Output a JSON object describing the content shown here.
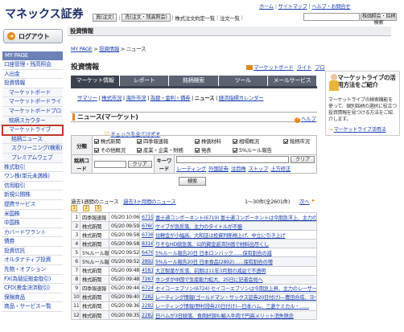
{
  "header": {
    "logo": "マネックス証券",
    "top_links": [
      "ホーム",
      "サイトマップ",
      "ヘルプ・お問合せ"
    ],
    "nav_buttons": [
      "買(注文)",
      "売(注文・残高照会)"
    ],
    "nav_links": [
      "株式注文約定一覧",
      "注文一覧"
    ],
    "search_button": "株価照会・銘柄検索"
  },
  "sidebar": {
    "logout": "ログアウト",
    "head": "MY PAGE",
    "items": [
      {
        "label": "口座管理・残高照会",
        "level": 0
      },
      {
        "label": "入出金",
        "level": 0
      },
      {
        "label": "投資情報",
        "level": 0
      },
      {
        "label": "マーケットボード",
        "level": 1
      },
      {
        "label": "マーケットボードライト",
        "level": 1
      },
      {
        "label": "マーケットボードプロ",
        "level": 1
      },
      {
        "label": "銘柄スカウター",
        "level": 1
      },
      {
        "label": "マーケットライブ",
        "level": 1,
        "active": true
      },
      {
        "label": "銘柄ニュース",
        "level": 2
      },
      {
        "label": "スクリーニング(検索)",
        "level": 2
      },
      {
        "label": "プレミアムウェブ",
        "level": 2
      },
      {
        "label": "株式取引",
        "level": 0
      },
      {
        "label": "ワン株(単元未満株)",
        "level": 0
      },
      {
        "label": "信用取引",
        "level": 0
      },
      {
        "label": "新規公開株",
        "level": 0
      },
      {
        "label": "提携サービス",
        "level": 0
      },
      {
        "label": "米国株",
        "level": 0
      },
      {
        "label": "中国株",
        "level": 0
      },
      {
        "label": "カバードワラント",
        "level": 0
      },
      {
        "label": "債券",
        "level": 0
      },
      {
        "label": "投資信託",
        "level": 0
      },
      {
        "label": "オルタナティブ投資",
        "level": 0
      },
      {
        "label": "先物・オプション",
        "level": 0
      },
      {
        "label": "FX(為替証拠金取引)",
        "level": 0
      },
      {
        "label": "CFD(差金決済取引)",
        "level": 0
      },
      {
        "label": "保険商品",
        "level": 0
      },
      {
        "label": "商品・サービス一覧",
        "level": 0
      }
    ]
  },
  "main": {
    "section": "投資情報",
    "breadcrumb": {
      "link1": "MY PAGE",
      "sep": " > ",
      "link2": "投資情報",
      "current": "ニュース"
    },
    "page_title": "投資情報",
    "sublinks": [
      "マーケットボード",
      "ライト",
      "プロ"
    ],
    "tabs": [
      "マーケット情報",
      "レポート",
      "銘柄検索",
      "ツール",
      "メールサービス"
    ],
    "subnav": {
      "items": [
        "サマリー",
        "株式市況",
        "海外市況",
        "為替・金利・債券",
        "ニュース",
        "経済指標カレンダー"
      ],
      "current_index": 4
    },
    "news_title": "ニュース(マーケット)",
    "help": "ヘルプ",
    "uncheck_all": "チェックを全てはずす",
    "filter": {
      "category_label": "分類",
      "categories": [
        {
          "label": "株式新聞",
          "checked": true
        },
        {
          "label": "四季報速報",
          "checked": true
        },
        {
          "label": "株価材料",
          "checked": true
        },
        {
          "label": "相場概況",
          "checked": true
        },
        {
          "label": "銘柄市況",
          "checked": true
        },
        {
          "label": "その他概況",
          "checked": true
        },
        {
          "label": "産業・企業・財務",
          "checked": true
        },
        {
          "label": "発表",
          "checked": true
        },
        {
          "label": "5%ルール報告",
          "checked": true
        }
      ],
      "code_label": "銘柄コード",
      "clear": "クリア",
      "keyword_label": "キーワード",
      "keyword_clear": "クリア",
      "keyword_links": [
        "レーティング",
        "外国証券",
        "注目株",
        "ストップ",
        "上方修正"
      ],
      "search": "検索"
    },
    "list_bar": {
      "period": "過去1週間のニュース",
      "switch": "過去3ヶ月間のニュース",
      "count": "1〜30件(全2601件)",
      "next": "次へ"
    },
    "pager": [
      "1",
      "2",
      "3"
    ],
    "rows": [
      {
        "n": "1",
        "cat": "四季報速報",
        "dt": "05/20 10:06",
        "code": "6719",
        "title": "富士通コンポーネント(6719) 富士通コンポーネントは今期急浮上、主力のパ…"
      },
      {
        "n": "2",
        "cat": "株式新聞",
        "dt": "05/20 09:59",
        "code": "6760",
        "title": "ケイブが急反落、主力のタイトルが不振"
      },
      {
        "n": "3",
        "cat": "株式新聞",
        "dt": "05/20 09:58",
        "code": "6738",
        "title": "住軽金が小幅高、大和証は投資判断格上げ、中立に引き上げ"
      },
      {
        "n": "4",
        "cat": "株式新聞",
        "dt": "05/20 09:58",
        "code": "8316",
        "title": "りそなHD続急落、公的資金返済計画で材料出尽くし"
      },
      {
        "n": "5",
        "cat": "5%ルール報告",
        "dt": "05/20 09:52",
        "code": "6476",
        "title": "5%ルール報告20日 日本ロンバック……保有割合の減"
      },
      {
        "n": "6",
        "cat": "5%ルール報告",
        "dt": "05/20 09:52",
        "code": "2892",
        "title": "5%ルール報告20日 日本食品(2892)……保有割合の増"
      },
      {
        "n": "7",
        "cat": "株式新聞",
        "dt": "05/20 09:48",
        "code": "4581",
        "title": "大正製薬が反落、前期は11年3月期の減益で不透明"
      },
      {
        "n": "8",
        "cat": "株式新聞",
        "dt": "05/20 09:48",
        "code": "7267",
        "title": "ホンダが中国で生産能力拡大、25日に記者会見へ"
      },
      {
        "n": "9",
        "cat": "四季報速報",
        "dt": "05/20 09:44",
        "code": "6724",
        "title": "セイコーエプソン(6724) セイコーエプソンは今期急上昇、主力のレーザー…"
      },
      {
        "n": "10",
        "cat": "株式新聞",
        "dt": "05/20 09:40",
        "code": "7282",
        "title": "レーティング情報(ゴールドマン・サックス証券20日付け)―豊田合成、ヨー…"
      },
      {
        "n": "11",
        "cat": "株式新聞",
        "dt": "05/20 09:36",
        "code": "2282",
        "title": "レーティング情報(野村證券20日付け)―日本ハム、三菱ケミカル・……"
      },
      {
        "n": "12",
        "cat": "株式新聞",
        "dt": "05/20 09:35",
        "code": "2282",
        "title": "日ハムが3日続落、食肉好調も輸入牛肉で円高メリット消失懸念"
      }
    ]
  },
  "promo": {
    "title": "マーケットライブの活用方法をご紹介",
    "body": "マーケットライブの検索機能を使って、個別銘柄の選択に役立つ投資情報を見つける方法をご紹介します。",
    "link": "マーケットライブ活用法"
  },
  "colors": {
    "sidebar_head": "#6c82b6",
    "tab": "#5b6373",
    "link": "#1a3fb0",
    "accent": "#e3861a"
  }
}
